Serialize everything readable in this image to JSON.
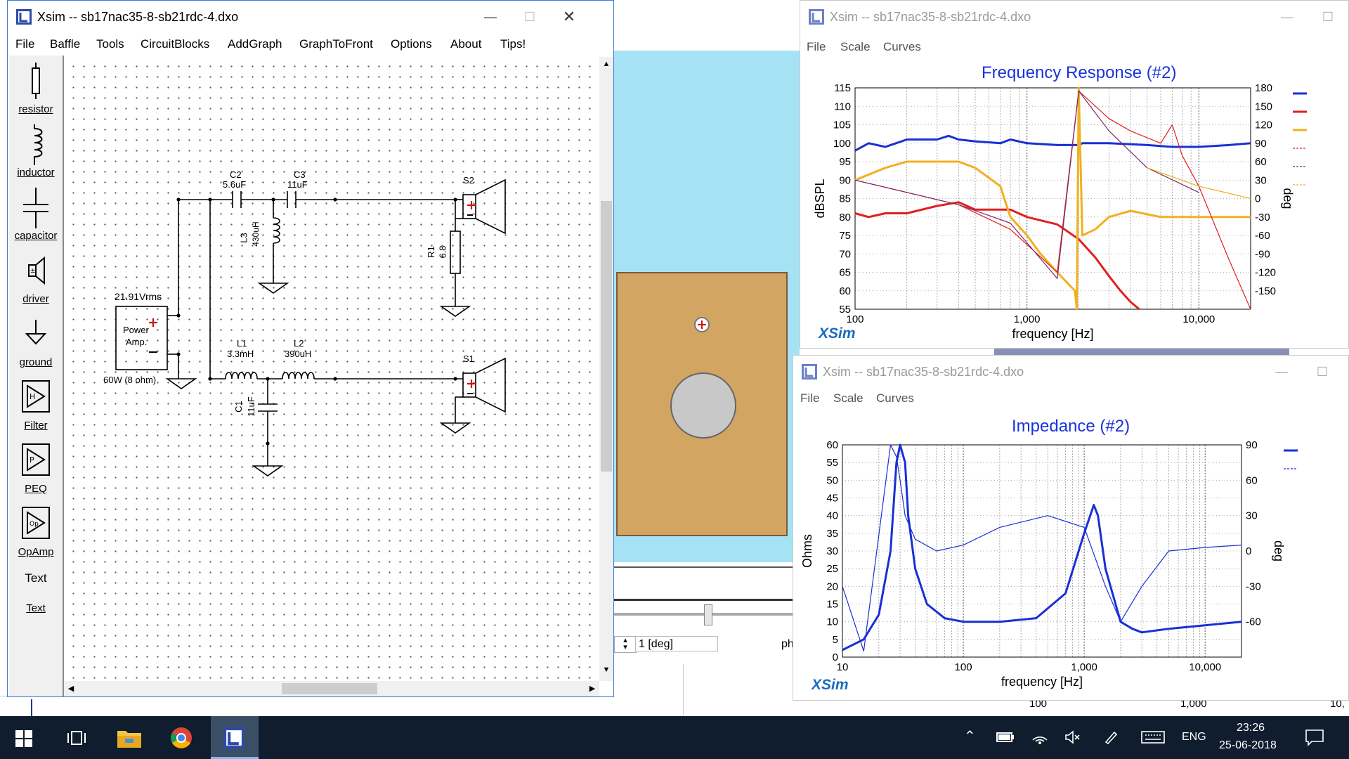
{
  "circuit_window": {
    "title": "Xsim -- sb17nac35-8-sb21rdc-4.dxo",
    "menu": [
      "File",
      "Baffle",
      "Tools",
      "CircuitBlocks",
      "AddGraph",
      "GraphToFront",
      "Options",
      "About",
      "Tips!"
    ],
    "tools": [
      {
        "label": "resistor",
        "icon": "resistor-icon"
      },
      {
        "label": "inductor",
        "icon": "inductor-icon"
      },
      {
        "label": "capacitor",
        "icon": "capacitor-icon"
      },
      {
        "label": "driver",
        "icon": "driver-icon"
      },
      {
        "label": "ground",
        "icon": "ground-icon"
      },
      {
        "label": "Filter",
        "icon": "filter-icon"
      },
      {
        "label": "PEQ",
        "icon": "peq-icon"
      },
      {
        "label": "OpAmp",
        "icon": "opamp-icon"
      },
      {
        "label": "Text",
        "icon": "text-icon"
      }
    ],
    "text_tool_glyph": "Text",
    "components": {
      "c2_name": "C2",
      "c2_value": "5.6uF",
      "c3_name": "C3",
      "c3_value": "11uF",
      "l3_name": "L3",
      "l3_value": "430uH",
      "r1_name": "R1",
      "r1_value": "6.8",
      "l1_name": "L1",
      "l1_value": "3.3mH",
      "l2_name": "L2",
      "l2_value": "390uH",
      "c1_name": "C1",
      "c1_value": "11uF",
      "s1_name": "S1",
      "s2_name": "S2",
      "amp_voltage": "21.91Vrms",
      "amp_label_1": "Power",
      "amp_label_2": "Amp.",
      "amp_power": "60W (8 ohm)"
    }
  },
  "baffle_panel": {
    "angle_value": "1 [deg]",
    "partial_label": "ph",
    "behind_axis_ticks": [
      "100",
      "1,000",
      "10,"
    ]
  },
  "freq_window": {
    "title": "Xsim -- sb17nac35-8-sb21rdc-4.dxo",
    "menu": [
      "File",
      "Scale",
      "Curves"
    ],
    "graph_title": "Frequency Response (#2)",
    "xlabel": "frequency [Hz]",
    "ylabel": "dBSPL",
    "y2label": "deg",
    "brand": "XSim",
    "y_ticks": [
      "115",
      "110",
      "105",
      "100",
      "95",
      "90",
      "85",
      "80",
      "75",
      "70",
      "65",
      "60",
      "55"
    ],
    "y2_ticks": [
      "180",
      "150",
      "120",
      "90",
      "60",
      "30",
      "0",
      "-30",
      "-60",
      "-90",
      "-120",
      "-150"
    ],
    "x_ticks": [
      "100",
      "1,000",
      "10,000"
    ]
  },
  "imp_window": {
    "title": "Xsim -- sb17nac35-8-sb21rdc-4.dxo",
    "menu": [
      "File",
      "Scale",
      "Curves"
    ],
    "graph_title": "Impedance (#2)",
    "xlabel": "frequency [Hz]",
    "ylabel": "Ohms",
    "y2label": "deg",
    "brand": "XSim",
    "y_ticks": [
      "60",
      "55",
      "50",
      "45",
      "40",
      "35",
      "30",
      "25",
      "20",
      "15",
      "10",
      "5",
      "0"
    ],
    "y2_ticks": [
      "90",
      "60",
      "30",
      "0",
      "-30",
      "-60"
    ],
    "x_ticks": [
      "10",
      "100",
      "1,000",
      "10,000"
    ]
  },
  "chart_data": [
    {
      "type": "line",
      "title": "Frequency Response (#2)",
      "xlabel": "frequency [Hz]",
      "ylabel": "dBSPL",
      "y2label": "deg",
      "xscale": "log",
      "xlim": [
        100,
        20000
      ],
      "ylim": [
        55,
        115
      ],
      "y2lim": [
        -180,
        180
      ],
      "grid": true,
      "series": [
        {
          "color": "#1a2fd6",
          "axis": "left",
          "x": [
            100,
            120,
            150,
            200,
            300,
            350,
            400,
            500,
            700,
            800,
            1000,
            1500,
            2000,
            2100,
            3000,
            5000,
            7000,
            10000,
            15000,
            20000
          ],
          "y": [
            98,
            100,
            99,
            101,
            101,
            102,
            101,
            100.5,
            100,
            101,
            100,
            99.5,
            99.5,
            100,
            100,
            99.5,
            99,
            99,
            99.5,
            100
          ]
        },
        {
          "color": "#e02020",
          "axis": "left",
          "x": [
            100,
            120,
            150,
            200,
            300,
            400,
            500,
            600,
            800,
            1000,
            1500,
            2000,
            2500,
            3000,
            3500,
            4000,
            4500
          ],
          "y": [
            81,
            80,
            81,
            81,
            83,
            84,
            82,
            82,
            82,
            80,
            78,
            74,
            69,
            64,
            60,
            57,
            55
          ]
        },
        {
          "color": "#f0b020",
          "axis": "right",
          "x": [
            100,
            150,
            200,
            300,
            400,
            500,
            700,
            800,
            1000,
            1200,
            1500,
            1900,
            1950,
            2000,
            2100,
            2500,
            3000,
            4000,
            6000,
            10000,
            20000
          ],
          "y": [
            30,
            50,
            60,
            60,
            60,
            50,
            20,
            -30,
            -60,
            -90,
            -120,
            -150,
            -180,
            180,
            -60,
            -50,
            -30,
            -20,
            -30,
            -30,
            -30
          ]
        },
        {
          "color": "#e02020",
          "dashed": true,
          "axis": "right",
          "x": [
            100,
            200,
            400,
            800,
            1500,
            2000,
            3000,
            4000,
            6000,
            7000,
            8000,
            10000,
            15000,
            20000
          ],
          "y": [
            30,
            10,
            -10,
            -50,
            -120,
            175,
            130,
            110,
            90,
            120,
            70,
            20,
            -100,
            -180
          ]
        },
        {
          "color": "#7a2a6a",
          "dashed": true,
          "axis": "right",
          "x": [
            100,
            200,
            400,
            800,
            1500,
            2000,
            3000,
            5000,
            10000
          ],
          "y": [
            30,
            10,
            -10,
            -40,
            -130,
            175,
            110,
            50,
            10
          ]
        },
        {
          "color": "#f0b020",
          "dashed": true,
          "axis": "right",
          "x": [
            5000,
            10000,
            20000
          ],
          "y": [
            50,
            20,
            0
          ]
        }
      ]
    },
    {
      "type": "line",
      "title": "Impedance (#2)",
      "xlabel": "frequency [Hz]",
      "ylabel": "Ohms",
      "y2label": "deg",
      "xscale": "log",
      "xlim": [
        10,
        20000
      ],
      "ylim": [
        0,
        60
      ],
      "y2lim": [
        -90,
        90
      ],
      "grid": true,
      "series": [
        {
          "color": "#1a2fd6",
          "axis": "left",
          "x": [
            10,
            15,
            20,
            25,
            28,
            30,
            33,
            35,
            40,
            50,
            70,
            100,
            200,
            400,
            700,
            1000,
            1200,
            1300,
            1500,
            2000,
            2500,
            3000,
            5000,
            10000,
            20000
          ],
          "y": [
            2,
            5,
            12,
            30,
            55,
            60,
            55,
            40,
            25,
            15,
            11,
            10,
            10,
            11,
            18,
            35,
            43,
            40,
            25,
            10,
            8,
            7,
            8,
            9,
            10
          ]
        },
        {
          "color": "#1a2fd6",
          "dashed": true,
          "axis": "right",
          "x": [
            10,
            15,
            25,
            28,
            30,
            33,
            40,
            60,
            100,
            200,
            500,
            1000,
            1500,
            2000,
            3000,
            5000,
            10000,
            20000
          ],
          "y": [
            -30,
            -85,
            90,
            80,
            60,
            30,
            10,
            0,
            5,
            20,
            30,
            20,
            -30,
            -60,
            -30,
            0,
            3,
            5
          ]
        }
      ]
    }
  ]
}
